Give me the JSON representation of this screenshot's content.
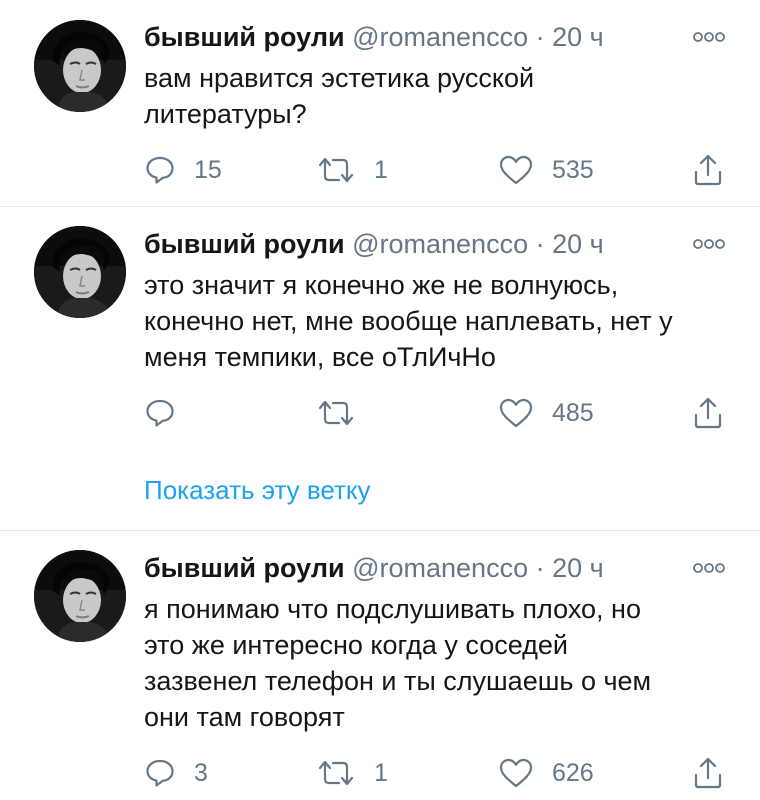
{
  "tweets": [
    {
      "name": "бывший роули",
      "handle": "@romanencco",
      "separator": "·",
      "time": "20 ч",
      "text_lines": [
        "вам нравится эстетика русской",
        "литературы?"
      ],
      "replies": "15",
      "retweets": "1",
      "likes": "535",
      "icons": {
        "reply": "reply-icon",
        "retweet": "retweet-icon",
        "like": "heart-icon",
        "share": "share-icon",
        "more": "more-icon"
      }
    },
    {
      "name": "бывший роули",
      "handle": "@romanencco",
      "separator": "·",
      "time": "20 ч",
      "text_lines": [
        "это значит я конечно же не волнуюсь,",
        "конечно нет, мне вообще наплевать, нет у",
        "меня темпики, все оТлИчНо"
      ],
      "replies": "",
      "retweets": "",
      "likes": "485",
      "show_thread": "Показать эту ветку"
    },
    {
      "name": "бывший роули",
      "handle": "@romanencco",
      "separator": "·",
      "time": "20 ч",
      "text_lines": [
        "я понимаю что подслушивать плохо, но",
        "это же интересно когда у соседей",
        "зазвенел телефон и ты слушаешь о чем",
        "они там говорят"
      ],
      "replies": "3",
      "retweets": "1",
      "likes": "626"
    }
  ],
  "colors": {
    "text": "#14171a",
    "secondary": "#657786",
    "link": "#1da1f2",
    "divider": "#e1e8ed"
  }
}
